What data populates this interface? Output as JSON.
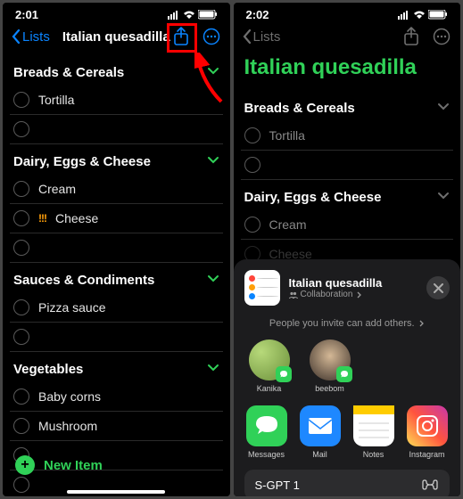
{
  "left": {
    "time": "2:01",
    "back": "Lists",
    "title": "Italian quesadilla",
    "sections": [
      {
        "name": "Breads & Cereals",
        "items": [
          "Tortilla",
          ""
        ]
      },
      {
        "name": "Dairy, Eggs & Cheese",
        "items": [
          "Cream",
          "Cheese",
          ""
        ],
        "flags": {
          "1": "!!!"
        }
      },
      {
        "name": "Sauces & Condiments",
        "items": [
          "Pizza sauce",
          ""
        ]
      },
      {
        "name": "Vegetables",
        "items": [
          "Baby corns",
          "Mushroom",
          ""
        ]
      }
    ],
    "newItem": "New Item"
  },
  "right": {
    "time": "2:02",
    "back": "Lists",
    "title": "Italian quesadilla",
    "sections": [
      {
        "name": "Breads & Cereals",
        "items": [
          "Tortilla",
          ""
        ]
      },
      {
        "name": "Dairy, Eggs & Cheese",
        "items": [
          "Cream",
          "Cheese"
        ]
      }
    ],
    "sheet": {
      "title": "Italian quesadilla",
      "subtitle": "Collaboration",
      "invite": "People you invite can add others.",
      "people": [
        "Kanika",
        "beebom"
      ],
      "apps": [
        "Messages",
        "Mail",
        "Notes",
        "Instagram"
      ],
      "shortcut": "S-GPT 1"
    }
  }
}
